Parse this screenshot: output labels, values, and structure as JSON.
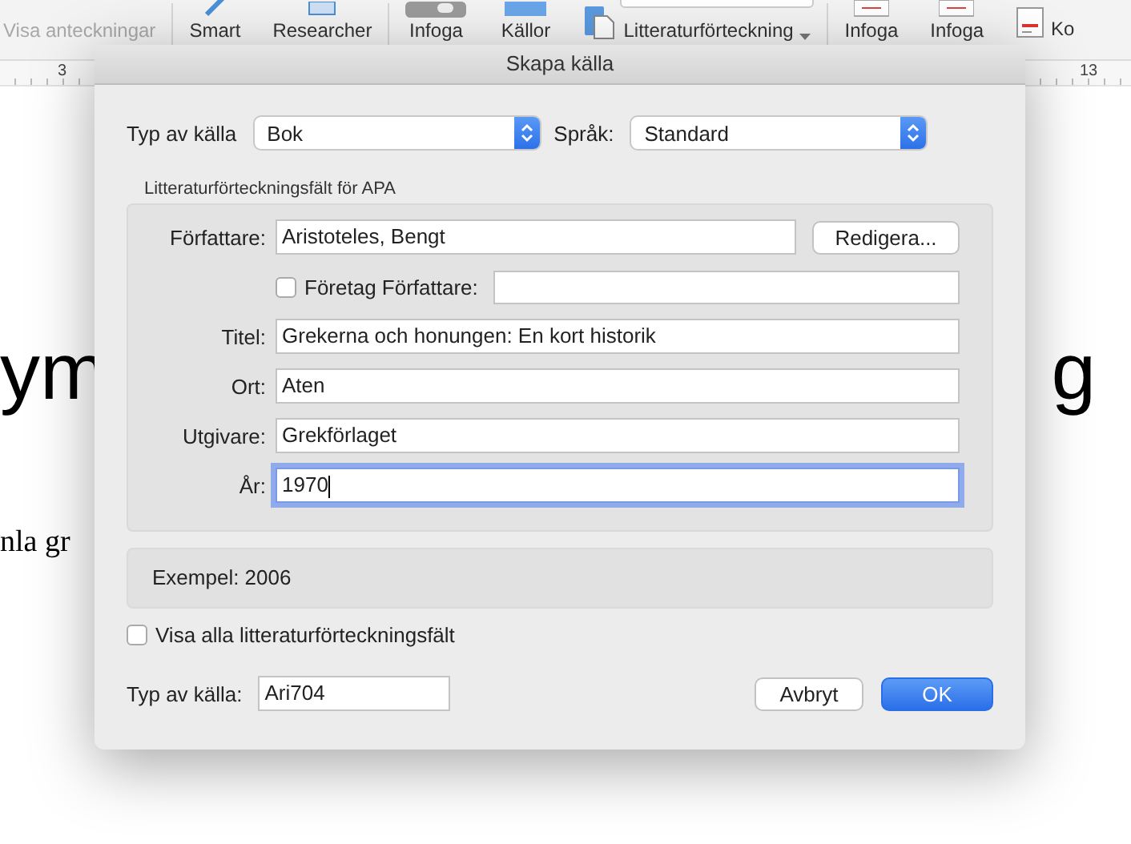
{
  "ribbon": {
    "items": [
      {
        "label": "Visa anteckningar",
        "disabled": true
      },
      {
        "label": "Smart",
        "disabled": false
      },
      {
        "label": "Researcher",
        "disabled": false
      },
      {
        "label": "Infoga",
        "disabled": false
      },
      {
        "label": "Källor",
        "disabled": false
      },
      {
        "label": "Litteraturförteckning",
        "disabled": false
      },
      {
        "label": "Infoga",
        "disabled": false
      },
      {
        "label": "Infoga",
        "disabled": false
      },
      {
        "label": "Ko",
        "disabled": false
      }
    ]
  },
  "ruler": {
    "marks": [
      "3",
      "13"
    ]
  },
  "document": {
    "heading_left": "ym",
    "heading_right": "g",
    "body": "nla gr"
  },
  "dialog": {
    "title": "Skapa källa",
    "source_type": {
      "label": "Typ av källa",
      "value": "Bok"
    },
    "language": {
      "label": "Språk:",
      "value": "Standard"
    },
    "group": {
      "title": "Litteraturförteckningsfält för APA",
      "fields": [
        {
          "kind": "author",
          "label": "Författare:",
          "value": "Aristoteles, Bengt",
          "button": "Redigera...",
          "focused": false
        },
        {
          "kind": "corporate",
          "label": "Företag Författare:",
          "checked": false,
          "focused": false
        },
        {
          "kind": "text",
          "label": "Titel:",
          "value": "Grekerna och honungen: En kort historik",
          "focused": false
        },
        {
          "kind": "text",
          "label": "Ort:",
          "value": "Aten",
          "focused": false
        },
        {
          "kind": "text",
          "label": "Utgivare:",
          "value": "Grekförlaget",
          "focused": false
        },
        {
          "kind": "text",
          "label": "År:",
          "value": "1970",
          "focused": true
        }
      ]
    },
    "example": "Exempel: 2006",
    "show_all": {
      "label": "Visa alla litteraturförteckningsfält",
      "checked": false
    },
    "tag": {
      "label": "Typ av källa:",
      "value": "Ari704"
    },
    "buttons": [
      {
        "label": "Avbryt",
        "default": false
      },
      {
        "label": "OK",
        "default": true
      }
    ]
  }
}
